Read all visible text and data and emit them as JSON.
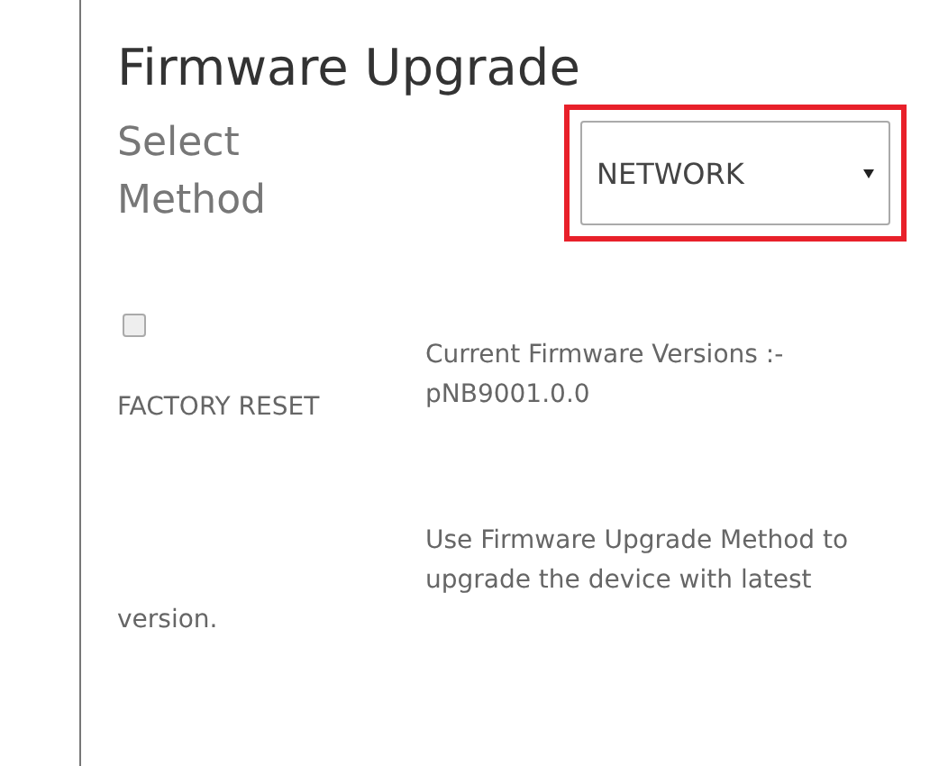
{
  "title": "Firmware Upgrade",
  "method": {
    "label": "Select Method",
    "value": "NETWORK",
    "highlighted": true
  },
  "factory_reset": {
    "label": "FACTORY RESET",
    "checked": false
  },
  "versions": {
    "label": "Current Firmware Versions :-",
    "value": "pNB9001.0.0"
  },
  "note": "Use Firmware Upgrade Method to upgrade the device with latest version."
}
